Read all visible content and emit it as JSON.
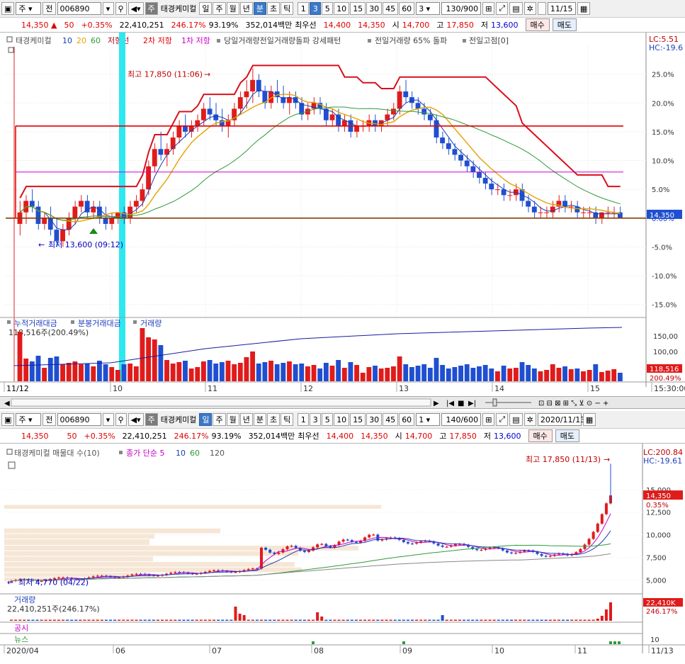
{
  "top": {
    "toolbar": {
      "market": "주",
      "mode": "전",
      "code": "006890",
      "tag": "주",
      "name": "태경케미컬",
      "periods": [
        "일",
        "주",
        "월",
        "년",
        "분",
        "초",
        "틱"
      ],
      "active_period": "분",
      "intervals": [
        "1",
        "3",
        "5",
        "10",
        "15",
        "30",
        "45",
        "60"
      ],
      "active_interval": "3",
      "interval_select": "3",
      "count": "130/900",
      "date": "11/15"
    },
    "quote": {
      "price": "14,350",
      "arrow": "▲",
      "change": "50",
      "rate": "+0.35%",
      "volume": "22,410,251",
      "vol_ratio": "246.17%",
      "strength": "93.19%",
      "amount": "352,014백만",
      "ask_label": "최우선",
      "ask": "14,400",
      "bid": "14,350",
      "open_label": "시",
      "open": "14,700",
      "high_label": "고",
      "high": "17,850",
      "low_label": "저",
      "low": "13,600",
      "buy": "매수",
      "sell": "매도"
    },
    "legend": {
      "name": "태경케미컬",
      "ma": [
        "10",
        "20",
        "60"
      ],
      "items": [
        "저항선",
        "2차 저항",
        "1차 저항"
      ],
      "extra": "당일거래량전일거래량돌파 강세패턴",
      "extra2": "전일거래량 65% 돌파",
      "extra3": "전일고점[0]",
      "lc": "LC:5.51",
      "hc": "HC:-19.6"
    },
    "chart_data": {
      "type": "candlestick",
      "y_axis_labels": [
        "25.0%",
        "20.0%",
        "15.0%",
        "10.0%",
        "5.0%",
        "0.00%",
        "-5.0%",
        "-10.0%",
        "-15.0%"
      ],
      "y_range_pct": [
        -17,
        30
      ],
      "price_tag": "14,350",
      "annotation_high": "최고 17,850 (11:06)",
      "annotation_low": "최저 13,600 (09:12)",
      "resistance_pct": [
        16.0,
        8.0,
        0.0
      ],
      "x_labels": [
        "11/12",
        "10",
        "11",
        "12",
        "13",
        "14",
        "15",
        "15:30:00"
      ],
      "candles_pct": [
        [
          -1,
          3,
          -3,
          1
        ],
        [
          1,
          4,
          -1,
          3
        ],
        [
          3,
          5,
          1,
          2
        ],
        [
          2,
          3,
          -2,
          -1
        ],
        [
          -1,
          1,
          -2,
          0
        ],
        [
          0,
          2,
          -3,
          -2
        ],
        [
          -2,
          0,
          -5,
          -4
        ],
        [
          -4,
          -1,
          -5,
          -2
        ],
        [
          -2,
          1,
          -3,
          0
        ],
        [
          0,
          3,
          -1,
          2
        ],
        [
          2,
          4,
          1,
          3
        ],
        [
          3,
          4,
          0,
          1
        ],
        [
          1,
          3,
          0,
          2
        ],
        [
          2,
          3,
          -1,
          0
        ],
        [
          0,
          2,
          -2,
          -1
        ],
        [
          -1,
          1,
          -2,
          0
        ],
        [
          0,
          1,
          -1,
          1
        ],
        [
          1,
          2,
          -1,
          0
        ],
        [
          0,
          3,
          -1,
          2
        ],
        [
          2,
          4,
          1,
          3
        ],
        [
          3,
          6,
          2,
          5
        ],
        [
          5,
          10,
          4,
          9
        ],
        [
          9,
          13,
          8,
          12
        ],
        [
          12,
          15,
          10,
          11
        ],
        [
          11,
          13,
          9,
          12
        ],
        [
          12,
          15,
          11,
          14
        ],
        [
          14,
          17,
          13,
          16
        ],
        [
          16,
          18,
          14,
          15
        ],
        [
          15,
          17,
          14,
          16
        ],
        [
          16,
          18,
          15,
          17
        ],
        [
          17,
          20,
          16,
          19
        ],
        [
          19,
          21,
          17,
          18
        ],
        [
          18,
          20,
          16,
          17
        ],
        [
          17,
          19,
          15,
          16
        ],
        [
          16,
          18,
          14,
          17
        ],
        [
          17,
          20,
          16,
          19
        ],
        [
          19,
          22,
          18,
          21
        ],
        [
          21,
          24,
          19,
          22
        ],
        [
          22,
          26,
          20,
          24
        ],
        [
          24,
          25,
          21,
          22
        ],
        [
          22,
          23,
          19,
          20
        ],
        [
          20,
          23,
          19,
          22
        ],
        [
          22,
          24,
          20,
          21
        ],
        [
          21,
          23,
          19,
          20
        ],
        [
          20,
          22,
          18,
          21
        ],
        [
          21,
          22,
          19,
          20
        ],
        [
          20,
          21,
          17,
          18
        ],
        [
          18,
          20,
          17,
          19
        ],
        [
          19,
          21,
          18,
          20
        ],
        [
          20,
          21,
          18,
          19
        ],
        [
          19,
          20,
          16,
          17
        ],
        [
          17,
          19,
          16,
          18
        ],
        [
          18,
          19,
          15,
          16
        ],
        [
          16,
          18,
          15,
          17
        ],
        [
          17,
          18,
          14,
          15
        ],
        [
          15,
          17,
          14,
          16
        ],
        [
          16,
          17,
          15,
          16
        ],
        [
          16,
          18,
          15,
          17
        ],
        [
          17,
          18,
          15,
          16
        ],
        [
          16,
          17,
          15,
          17
        ],
        [
          17,
          19,
          16,
          18
        ],
        [
          18,
          20,
          17,
          19
        ],
        [
          19,
          23,
          18,
          22
        ],
        [
          22,
          24,
          20,
          21
        ],
        [
          21,
          22,
          19,
          20
        ],
        [
          20,
          21,
          18,
          19
        ],
        [
          19,
          20,
          17,
          18
        ],
        [
          18,
          19,
          16,
          17
        ],
        [
          17,
          18,
          13,
          14
        ],
        [
          14,
          15,
          12,
          13
        ],
        [
          13,
          14,
          11,
          12
        ],
        [
          12,
          13,
          10,
          11
        ],
        [
          11,
          12,
          9,
          10
        ],
        [
          10,
          11,
          8,
          9
        ],
        [
          9,
          10,
          7,
          8
        ],
        [
          8,
          9,
          6,
          7
        ],
        [
          7,
          8,
          5,
          6
        ],
        [
          6,
          7,
          4,
          5
        ],
        [
          5,
          6,
          4,
          5
        ],
        [
          5,
          6,
          3,
          4
        ],
        [
          4,
          5,
          3,
          4
        ],
        [
          4,
          6,
          3,
          5
        ],
        [
          5,
          6,
          2,
          3
        ],
        [
          3,
          4,
          1,
          2
        ],
        [
          2,
          3,
          0,
          1
        ],
        [
          1,
          2,
          0,
          1
        ],
        [
          1,
          2,
          0,
          1
        ],
        [
          1,
          3,
          0,
          2
        ],
        [
          2,
          4,
          1,
          3
        ],
        [
          3,
          4,
          1,
          2
        ],
        [
          2,
          3,
          1,
          2
        ],
        [
          2,
          3,
          0,
          1
        ],
        [
          1,
          2,
          0,
          1
        ],
        [
          1,
          2,
          0,
          1
        ],
        [
          1,
          2,
          -1,
          0
        ],
        [
          0,
          1,
          -1,
          1
        ],
        [
          1,
          2,
          0,
          1
        ],
        [
          1,
          2,
          0,
          1
        ],
        [
          1,
          2,
          0,
          0
        ]
      ],
      "volume_title": "누적거래대금",
      "volume_title2": "분봉거래대금",
      "volume_title3": "거래량",
      "volume_value": "118,516주(200.49%)",
      "volume_axis": [
        "150,00",
        "100,00",
        "50,00"
      ],
      "volume_tag": "118,516",
      "volume_tag2": "200.49%"
    }
  },
  "bottom": {
    "toolbar": {
      "market": "주",
      "mode": "전",
      "code": "006890",
      "tag": "주",
      "name": "태경케미컬",
      "periods": [
        "일",
        "주",
        "월",
        "년",
        "분",
        "초",
        "틱"
      ],
      "active_period": "일",
      "intervals": [
        "1",
        "3",
        "5",
        "10",
        "15",
        "30",
        "45",
        "60"
      ],
      "interval_select": "1",
      "count": "140/600",
      "date": "2020/11/13"
    },
    "quote": {
      "price": "14,350",
      "change": "50",
      "rate": "+0.35%",
      "volume": "22,410,251",
      "vol_ratio": "246.17%",
      "strength": "93.19%",
      "amount": "352,014백만",
      "ask_label": "최우선",
      "ask": "14,400",
      "bid": "14,350",
      "open_label": "시",
      "open": "14,700",
      "high_label": "고",
      "high": "17,850",
      "low_label": "저",
      "low": "13,600",
      "buy": "매수",
      "sell": "매도"
    },
    "legend": {
      "name": "태경케미컬 매물대 수(10)",
      "extra": "종가 단순 5",
      "ma": [
        "10",
        "60",
        "120"
      ],
      "lc": "LC:200.84",
      "hc": "HC:-19.61"
    },
    "chart_data": {
      "type": "candlestick",
      "y_axis_labels": [
        "15,000",
        "12,500",
        "10,000",
        "7,500",
        "5,000"
      ],
      "y_range": [
        3800,
        18500
      ],
      "price_tag": "14,350",
      "price_tag2": "0.35%",
      "annotation_high": "최고 17,850 (11/13)",
      "annotation_low": "최저 4,770 (04/22)",
      "x_labels": [
        "2020/04",
        "06",
        "07",
        "08",
        "09",
        "10",
        "11",
        "11/13"
      ],
      "volume_title": "거래량",
      "volume_value": "22,410,251주(246.17%)",
      "volume_tag": "22,410K",
      "volume_tag2": "246.17%",
      "sub1": "공시",
      "sub2": "뉴스",
      "sub_axis": "10"
    }
  }
}
